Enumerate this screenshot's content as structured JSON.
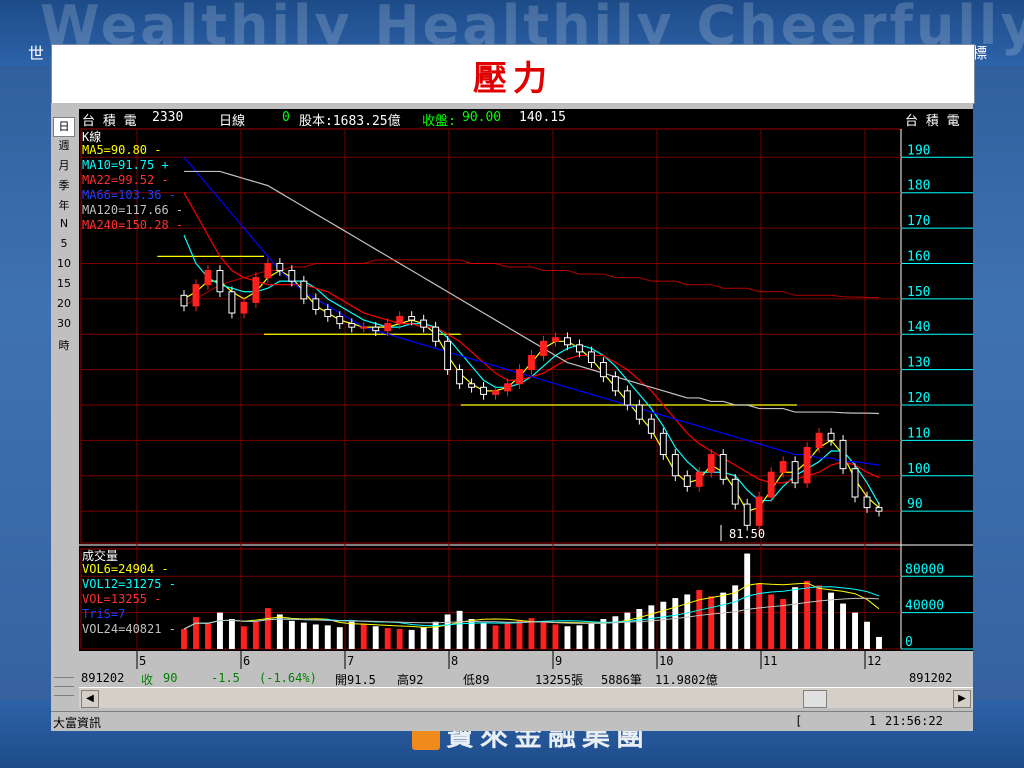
{
  "slide": {
    "title": "壓力",
    "banner_slogan": "Wealthily Healthily Cheerfully",
    "banner_left": "世",
    "banner_right": "標",
    "footer_brand": "寶來金融集團"
  },
  "colors": {
    "title": "#e00000",
    "ma5": "#ffff00",
    "ma10": "#00ffff",
    "ma22": "#ff0000",
    "ma66": "#0000ff",
    "ma120": "#c0c0c0",
    "ma240": "#ff0000",
    "candle_up": "#ff2020",
    "candle_down": "#ffffff",
    "support": "#ffff00",
    "price_axis": "#00ffff"
  },
  "header": {
    "stock_name": "台 積 電",
    "code": "2330",
    "period": "日線",
    "zero": "0",
    "capital": "股本:1683.25億",
    "close_label": "收盤:",
    "close_value": "90.00",
    "other_value": "140.15",
    "right_name": "台 積 電"
  },
  "legend": {
    "kline": "K線",
    "ma5": "MA5=90.80 -",
    "ma10": "MA10=91.75 +",
    "ma22": "MA22=99.52 -",
    "ma66": "MA66=103.36 -",
    "ma120": "MA120=117.66 -",
    "ma240": "MA240=150.28 -"
  },
  "volume_legend": {
    "title": "成交量",
    "vol6": "VOL6=24904 -",
    "vol12": "VOL12=31275 -",
    "vol": "VOL=13255 -",
    "tris": "TriS=7",
    "vol24": "VOL24=40821 -"
  },
  "sidebar": [
    "日",
    "週",
    "月",
    "季",
    "年",
    "N",
    "5",
    "10",
    "15",
    "20",
    "30",
    "時"
  ],
  "low_marker": "81.50",
  "info_bar": {
    "date": "891202",
    "close_label": "收",
    "close": "90",
    "change": "-1.5",
    "change_pct": "(-1.64%)",
    "open": "開91.5",
    "high": "高92",
    "low": "低89",
    "volume": "13255張",
    "trades": "5886筆",
    "amount": "11.9802億"
  },
  "date_right": "891202",
  "status": {
    "left": "大富資訊",
    "mid": "[",
    "num": "1",
    "time": "21:56:22"
  },
  "chart_data": {
    "type": "candlestick",
    "price_ticks": [
      190,
      180,
      170,
      160,
      150,
      140,
      130,
      120,
      110,
      100,
      90
    ],
    "price_range": [
      81,
      198
    ],
    "volume_ticks": [
      "80000",
      "40000",
      "0"
    ],
    "volume_range": [
      0,
      110000
    ],
    "month_labels": [
      "5",
      "6",
      "7",
      "8",
      "9",
      "10",
      "11",
      "12"
    ],
    "close_series": [
      148,
      154,
      158,
      152,
      146,
      149,
      156,
      160,
      158,
      155,
      150,
      147,
      145,
      143,
      142,
      142,
      141,
      143,
      145,
      144,
      142,
      138,
      130,
      126,
      125,
      123,
      124,
      126,
      130,
      134,
      138,
      139,
      137,
      135,
      132,
      128,
      124,
      120,
      116,
      112,
      106,
      100,
      97,
      101,
      106,
      99,
      92,
      86,
      94,
      101,
      104,
      98,
      108,
      112,
      110,
      102,
      94,
      91,
      90
    ],
    "ma_series": {
      "ma5": [
        150,
        152,
        155,
        155,
        152,
        150,
        152,
        156,
        158,
        156,
        152,
        148,
        146,
        144,
        143,
        142,
        142,
        142,
        143,
        144,
        143,
        140,
        134,
        129,
        126,
        124,
        124,
        125,
        128,
        132,
        136,
        138,
        138,
        136,
        133,
        129,
        125,
        121,
        117,
        113,
        107,
        101,
        98,
        99,
        103,
        101,
        96,
        90,
        91,
        96,
        101,
        101,
        104,
        108,
        110,
        106,
        99,
        94,
        91
      ],
      "ma10": [
        168,
        160,
        156,
        154,
        153,
        152,
        152,
        153,
        155,
        155,
        155,
        153,
        150,
        148,
        146,
        144,
        143,
        142,
        142,
        143,
        143,
        142,
        139,
        135,
        131,
        127,
        125,
        125,
        126,
        128,
        131,
        134,
        136,
        137,
        136,
        134,
        131,
        127,
        123,
        119,
        114,
        108,
        104,
        101,
        101,
        101,
        100,
        96,
        93,
        93,
        97,
        100,
        102,
        104,
        107,
        107,
        103,
        98,
        92
      ],
      "ma22": [
        180,
        174,
        168,
        162,
        158,
        156,
        155,
        154,
        154,
        154,
        154,
        153,
        152,
        150,
        148,
        146,
        145,
        144,
        143,
        143,
        142,
        142,
        140,
        138,
        135,
        132,
        129,
        127,
        127,
        128,
        129,
        131,
        133,
        134,
        134,
        134,
        132,
        130,
        127,
        124,
        120,
        116,
        112,
        109,
        107,
        105,
        103,
        101,
        99,
        98,
        98,
        99,
        100,
        101,
        103,
        104,
        103,
        101,
        99.5
      ],
      "ma66": [
        190,
        186,
        182,
        178,
        174,
        170,
        166,
        162,
        158,
        155,
        152,
        150,
        148,
        146,
        144,
        142,
        141,
        140,
        139,
        138,
        137,
        136,
        135,
        134,
        133,
        132,
        131,
        130,
        129,
        128,
        127,
        126,
        125,
        124,
        123,
        122,
        121,
        120,
        119,
        118,
        117,
        116,
        115,
        114,
        113,
        112,
        111,
        110,
        109,
        108,
        107,
        106,
        106,
        105,
        105,
        104,
        104,
        103.5,
        103
      ],
      "ma120": [
        186,
        186,
        186,
        186,
        185,
        184,
        183,
        182,
        180,
        178,
        176,
        174,
        172,
        170,
        168,
        166,
        164,
        162,
        160,
        158,
        156,
        154,
        152,
        150,
        148,
        146,
        144,
        142,
        140,
        138,
        136,
        134,
        132,
        131,
        130,
        129,
        128,
        127,
        126,
        125,
        124,
        123,
        122,
        122,
        121,
        121,
        120,
        120,
        119,
        119,
        119,
        118,
        118,
        118,
        118,
        117.8,
        117.7,
        117.7,
        117.6
      ],
      "ma240": [
        148,
        150,
        152,
        154,
        155,
        156,
        157,
        158,
        158,
        159,
        159,
        160,
        160,
        160,
        160,
        160,
        161,
        161,
        161,
        161,
        161,
        161,
        161,
        161,
        160,
        160,
        160,
        159,
        159,
        159,
        158,
        158,
        158,
        157,
        157,
        157,
        156,
        156,
        156,
        155,
        155,
        155,
        154,
        154,
        154,
        153,
        153,
        153,
        152,
        152,
        152,
        151,
        151,
        151,
        151,
        150.6,
        150.5,
        150.4,
        150.3
      ]
    },
    "volumes": [
      22000,
      35000,
      28000,
      40000,
      33000,
      25000,
      30000,
      45000,
      38000,
      31000,
      29000,
      27000,
      26000,
      24000,
      30000,
      28000,
      25000,
      23000,
      22000,
      21000,
      24000,
      30000,
      38000,
      42000,
      33000,
      29000,
      26000,
      28000,
      31000,
      34000,
      30000,
      27000,
      25000,
      26000,
      29000,
      33000,
      36000,
      40000,
      44000,
      48000,
      52000,
      56000,
      60000,
      65000,
      58000,
      62000,
      70000,
      105000,
      72000,
      60000,
      55000,
      68000,
      75000,
      70000,
      62000,
      50000,
      40000,
      30000,
      13255
    ],
    "support_lines": [
      {
        "from": 0.02,
        "to": 0.15,
        "price": 162
      },
      {
        "from": 0.15,
        "to": 0.39,
        "price": 140
      },
      {
        "from": 0.39,
        "to": 0.8,
        "price": 120
      }
    ]
  }
}
